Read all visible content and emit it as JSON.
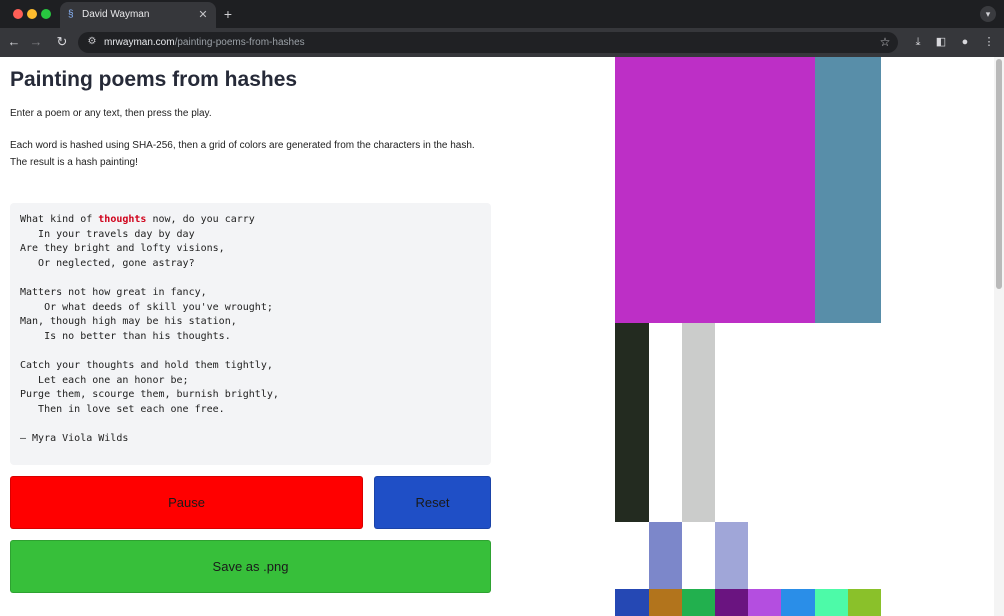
{
  "browser": {
    "tab_title": "David Wayman",
    "url_host": "mrwayman.com",
    "url_path": "/painting-poems-from-hashes"
  },
  "page": {
    "title": "Painting poems from hashes",
    "intro": "Enter a poem or any text, then press the play.",
    "desc_line1": "Each word is hashed using SHA-256, then a grid of colors are generated from the characters in the hash.",
    "desc_line2": "The result is a hash painting!"
  },
  "poem": {
    "line1_before": "What kind of ",
    "highlighted_word": "thoughts",
    "line1_after": " now, do you carry",
    "rest": "   In your travels day by day\nAre they bright and lofty visions,\n   Or neglected, gone astray?\n\nMatters not how great in fancy,\n    Or what deeds of skill you've wrought;\nMan, though high may be his station,\n    Is no better than his thoughts.\n\nCatch your thoughts and hold them tightly,\n   Let each one an honor be;\nPurge them, scourge them, burnish brightly,\n   Then in love set each one free.\n\n— Myra Viola Wilds"
  },
  "buttons": {
    "pause": "Pause",
    "reset": "Reset",
    "save": "Save as .png"
  },
  "colors": {
    "pause": "#ff0000",
    "reset": "#1f4fc6",
    "save": "#37bf3a",
    "highlight": "#d0021b",
    "painting": [
      "#bd2fc6",
      "#588ea9",
      "#232b20",
      "#ffffff",
      "#cbcccb",
      "#7c87ca",
      "#a0a6d8",
      "#2548b4",
      "#b2741c",
      "#22b04e",
      "#6a1480",
      "#b44ee0",
      "#2a8ee8",
      "#4dfaa8",
      "#8ac12a"
    ]
  }
}
